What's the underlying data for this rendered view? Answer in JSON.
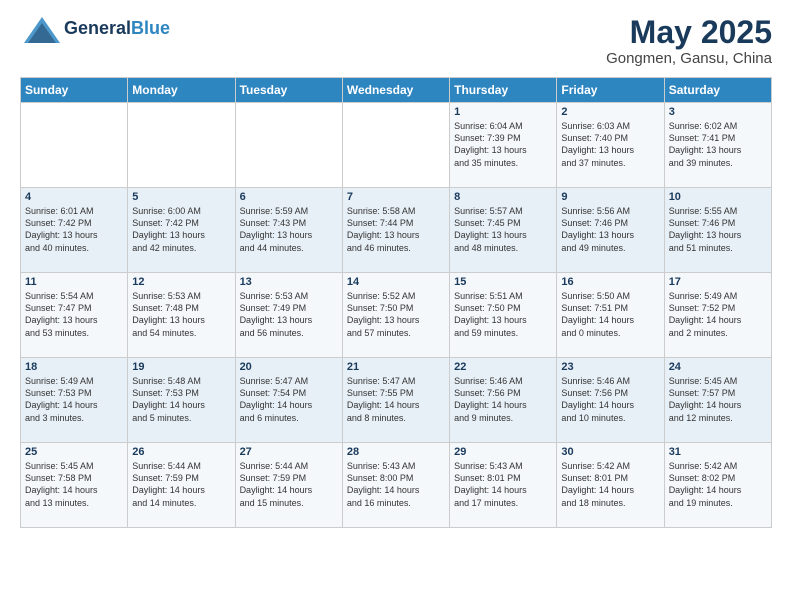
{
  "header": {
    "logo_line1": "General",
    "logo_line2": "Blue",
    "title": "May 2025",
    "subtitle": "Gongmen, Gansu, China"
  },
  "days_of_week": [
    "Sunday",
    "Monday",
    "Tuesday",
    "Wednesday",
    "Thursday",
    "Friday",
    "Saturday"
  ],
  "weeks": [
    [
      {
        "day": "",
        "info": ""
      },
      {
        "day": "",
        "info": ""
      },
      {
        "day": "",
        "info": ""
      },
      {
        "day": "",
        "info": ""
      },
      {
        "day": "1",
        "info": "Sunrise: 6:04 AM\nSunset: 7:39 PM\nDaylight: 13 hours\nand 35 minutes."
      },
      {
        "day": "2",
        "info": "Sunrise: 6:03 AM\nSunset: 7:40 PM\nDaylight: 13 hours\nand 37 minutes."
      },
      {
        "day": "3",
        "info": "Sunrise: 6:02 AM\nSunset: 7:41 PM\nDaylight: 13 hours\nand 39 minutes."
      }
    ],
    [
      {
        "day": "4",
        "info": "Sunrise: 6:01 AM\nSunset: 7:42 PM\nDaylight: 13 hours\nand 40 minutes."
      },
      {
        "day": "5",
        "info": "Sunrise: 6:00 AM\nSunset: 7:42 PM\nDaylight: 13 hours\nand 42 minutes."
      },
      {
        "day": "6",
        "info": "Sunrise: 5:59 AM\nSunset: 7:43 PM\nDaylight: 13 hours\nand 44 minutes."
      },
      {
        "day": "7",
        "info": "Sunrise: 5:58 AM\nSunset: 7:44 PM\nDaylight: 13 hours\nand 46 minutes."
      },
      {
        "day": "8",
        "info": "Sunrise: 5:57 AM\nSunset: 7:45 PM\nDaylight: 13 hours\nand 48 minutes."
      },
      {
        "day": "9",
        "info": "Sunrise: 5:56 AM\nSunset: 7:46 PM\nDaylight: 13 hours\nand 49 minutes."
      },
      {
        "day": "10",
        "info": "Sunrise: 5:55 AM\nSunset: 7:46 PM\nDaylight: 13 hours\nand 51 minutes."
      }
    ],
    [
      {
        "day": "11",
        "info": "Sunrise: 5:54 AM\nSunset: 7:47 PM\nDaylight: 13 hours\nand 53 minutes."
      },
      {
        "day": "12",
        "info": "Sunrise: 5:53 AM\nSunset: 7:48 PM\nDaylight: 13 hours\nand 54 minutes."
      },
      {
        "day": "13",
        "info": "Sunrise: 5:53 AM\nSunset: 7:49 PM\nDaylight: 13 hours\nand 56 minutes."
      },
      {
        "day": "14",
        "info": "Sunrise: 5:52 AM\nSunset: 7:50 PM\nDaylight: 13 hours\nand 57 minutes."
      },
      {
        "day": "15",
        "info": "Sunrise: 5:51 AM\nSunset: 7:50 PM\nDaylight: 13 hours\nand 59 minutes."
      },
      {
        "day": "16",
        "info": "Sunrise: 5:50 AM\nSunset: 7:51 PM\nDaylight: 14 hours\nand 0 minutes."
      },
      {
        "day": "17",
        "info": "Sunrise: 5:49 AM\nSunset: 7:52 PM\nDaylight: 14 hours\nand 2 minutes."
      }
    ],
    [
      {
        "day": "18",
        "info": "Sunrise: 5:49 AM\nSunset: 7:53 PM\nDaylight: 14 hours\nand 3 minutes."
      },
      {
        "day": "19",
        "info": "Sunrise: 5:48 AM\nSunset: 7:53 PM\nDaylight: 14 hours\nand 5 minutes."
      },
      {
        "day": "20",
        "info": "Sunrise: 5:47 AM\nSunset: 7:54 PM\nDaylight: 14 hours\nand 6 minutes."
      },
      {
        "day": "21",
        "info": "Sunrise: 5:47 AM\nSunset: 7:55 PM\nDaylight: 14 hours\nand 8 minutes."
      },
      {
        "day": "22",
        "info": "Sunrise: 5:46 AM\nSunset: 7:56 PM\nDaylight: 14 hours\nand 9 minutes."
      },
      {
        "day": "23",
        "info": "Sunrise: 5:46 AM\nSunset: 7:56 PM\nDaylight: 14 hours\nand 10 minutes."
      },
      {
        "day": "24",
        "info": "Sunrise: 5:45 AM\nSunset: 7:57 PM\nDaylight: 14 hours\nand 12 minutes."
      }
    ],
    [
      {
        "day": "25",
        "info": "Sunrise: 5:45 AM\nSunset: 7:58 PM\nDaylight: 14 hours\nand 13 minutes."
      },
      {
        "day": "26",
        "info": "Sunrise: 5:44 AM\nSunset: 7:59 PM\nDaylight: 14 hours\nand 14 minutes."
      },
      {
        "day": "27",
        "info": "Sunrise: 5:44 AM\nSunset: 7:59 PM\nDaylight: 14 hours\nand 15 minutes."
      },
      {
        "day": "28",
        "info": "Sunrise: 5:43 AM\nSunset: 8:00 PM\nDaylight: 14 hours\nand 16 minutes."
      },
      {
        "day": "29",
        "info": "Sunrise: 5:43 AM\nSunset: 8:01 PM\nDaylight: 14 hours\nand 17 minutes."
      },
      {
        "day": "30",
        "info": "Sunrise: 5:42 AM\nSunset: 8:01 PM\nDaylight: 14 hours\nand 18 minutes."
      },
      {
        "day": "31",
        "info": "Sunrise: 5:42 AM\nSunset: 8:02 PM\nDaylight: 14 hours\nand 19 minutes."
      }
    ]
  ]
}
